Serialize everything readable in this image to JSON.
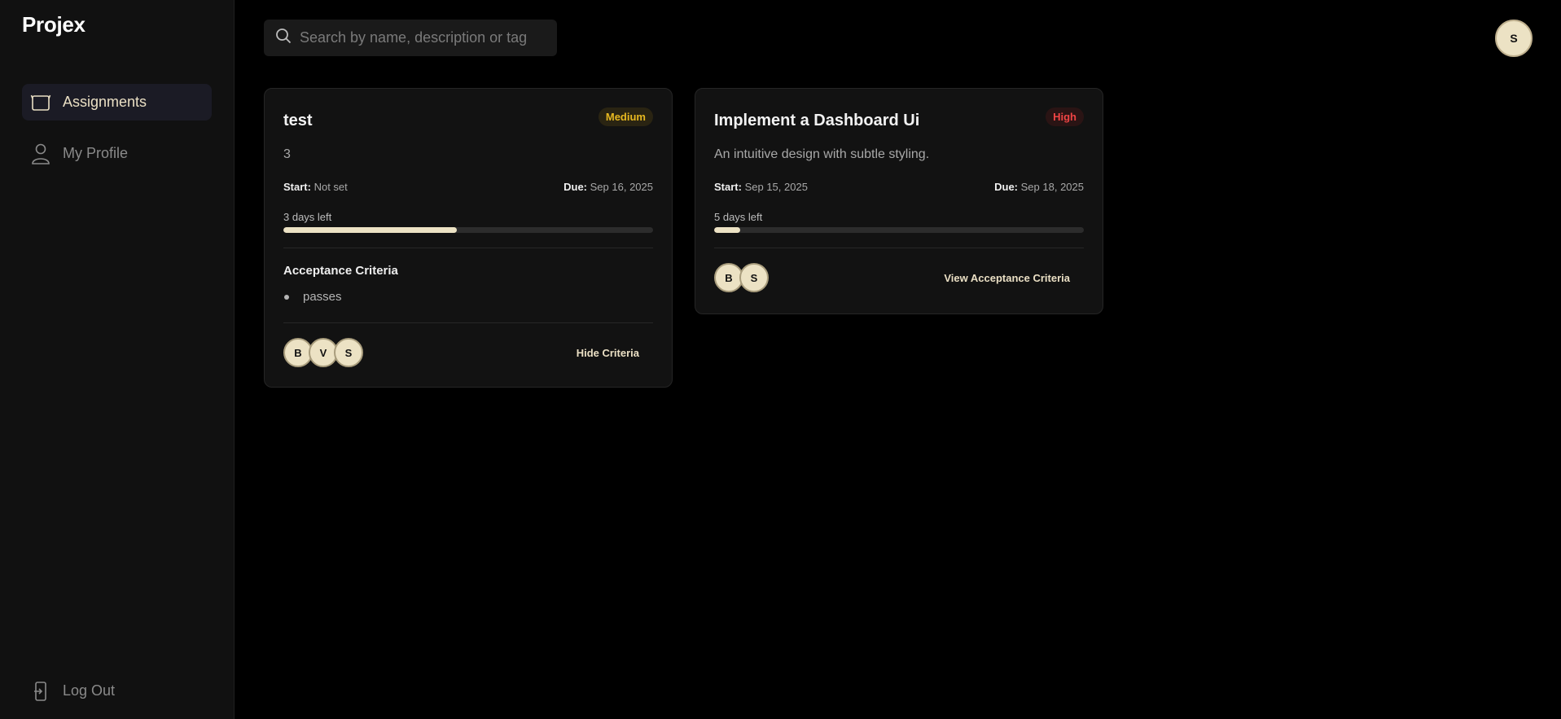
{
  "brand": "Projex",
  "nav": {
    "assignments": "Assignments",
    "profile": "My Profile",
    "logout": "Log Out"
  },
  "search": {
    "placeholder": "Search by name, description or tag"
  },
  "user": {
    "initial": "S"
  },
  "cards": [
    {
      "title": "test",
      "priority": "Medium",
      "description": "3",
      "start_label": "Start:",
      "start_value": "Not set",
      "due_label": "Due:",
      "due_value": "Sep 16, 2025",
      "days_left": "3 days left",
      "progress": 0.47,
      "criteria_title": "Acceptance Criteria",
      "criteria": [
        "passes"
      ],
      "members": [
        "B",
        "V",
        "S"
      ],
      "criteria_button": "Hide Criteria"
    },
    {
      "title": "Implement a Dashboard Ui",
      "priority": "High",
      "description": "An intuitive design with subtle styling.",
      "start_label": "Start:",
      "start_value": "Sep 15, 2025",
      "due_label": "Due:",
      "due_value": "Sep 18, 2025",
      "days_left": "5 days left",
      "progress": 0.07,
      "members": [
        "B",
        "S"
      ],
      "criteria_button": "View Acceptance Criteria"
    }
  ],
  "colors": {
    "accent": "#ece2c4",
    "priority_medium": "#e7b820",
    "priority_high": "#ef4444",
    "background": "#000000",
    "sidebar": "#111111",
    "card": "#121212"
  },
  "icons": {
    "assignments": "clipboard-icon",
    "profile": "user-icon",
    "logout": "logout-icon",
    "search": "search-icon"
  }
}
